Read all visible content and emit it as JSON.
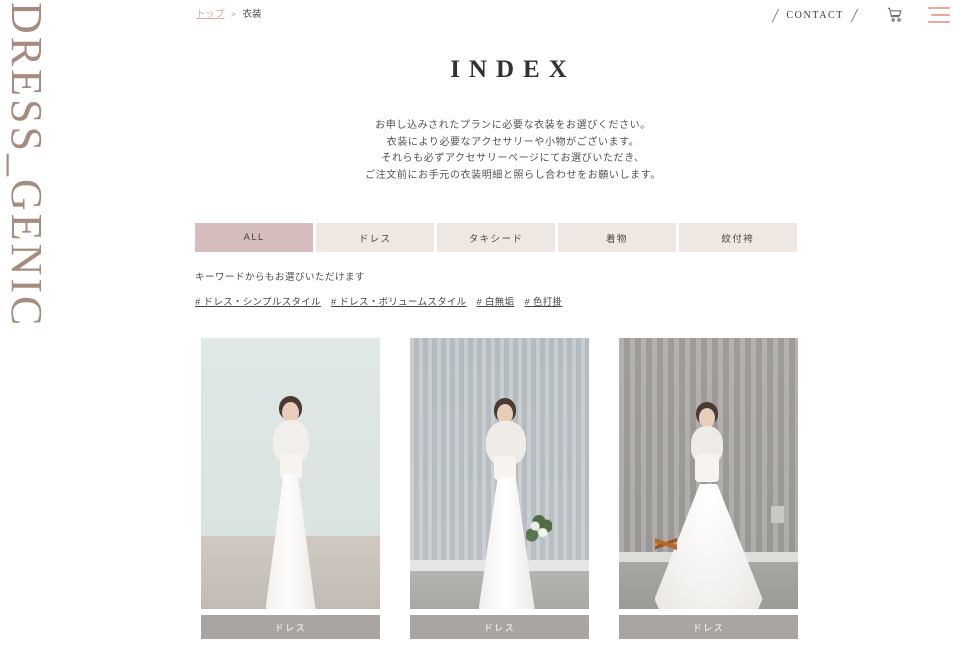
{
  "site": {
    "logo": "DRESS_GENIC",
    "logo_color": "#a68c7f"
  },
  "header": {
    "breadcrumb": {
      "home_label": "トップ",
      "separator": ">",
      "current_label": "衣装"
    },
    "contact_label": "CONTACT",
    "cart_icon": "shopping-cart-icon",
    "menu_icon": "hamburger-menu-icon",
    "accent_color": "#eda79c"
  },
  "main": {
    "title": "INDEX",
    "lead_lines": [
      "お申し込みされたプランに必要な衣装をお選びください。",
      "衣装により必要なアクセサリーや小物がございます。",
      "それらも必ずアクセサリーページにてお選びいただき、",
      "ご注文前にお手元の衣装明細と照らし合わせをお願いします。"
    ],
    "filters": [
      {
        "label": "ALL",
        "active": true
      },
      {
        "label": "ドレス",
        "active": false
      },
      {
        "label": "タキシード",
        "active": false
      },
      {
        "label": "着物",
        "active": false
      },
      {
        "label": "紋付袴",
        "active": false
      }
    ],
    "filter_active_color": "#d6bdbd",
    "filter_inactive_color": "#efe7e2",
    "keyword_heading": "キーワードからもお選びいただけます",
    "keyword_tags": [
      "# ドレス・シンプルスタイル",
      "# ドレス・ボリュームスタイル",
      "# 白無垢",
      "# 色打掛"
    ],
    "products": [
      {
        "label": "ドレス",
        "alt": "bride-in-lace-bodice-sheath-dress"
      },
      {
        "label": "ドレス",
        "alt": "bride-with-green-bouquet-lace-dress"
      },
      {
        "label": "ドレス",
        "alt": "bride-in-tulle-ballgown-with-dried-botanicals"
      }
    ],
    "product_label_color": "#aba5a1"
  }
}
